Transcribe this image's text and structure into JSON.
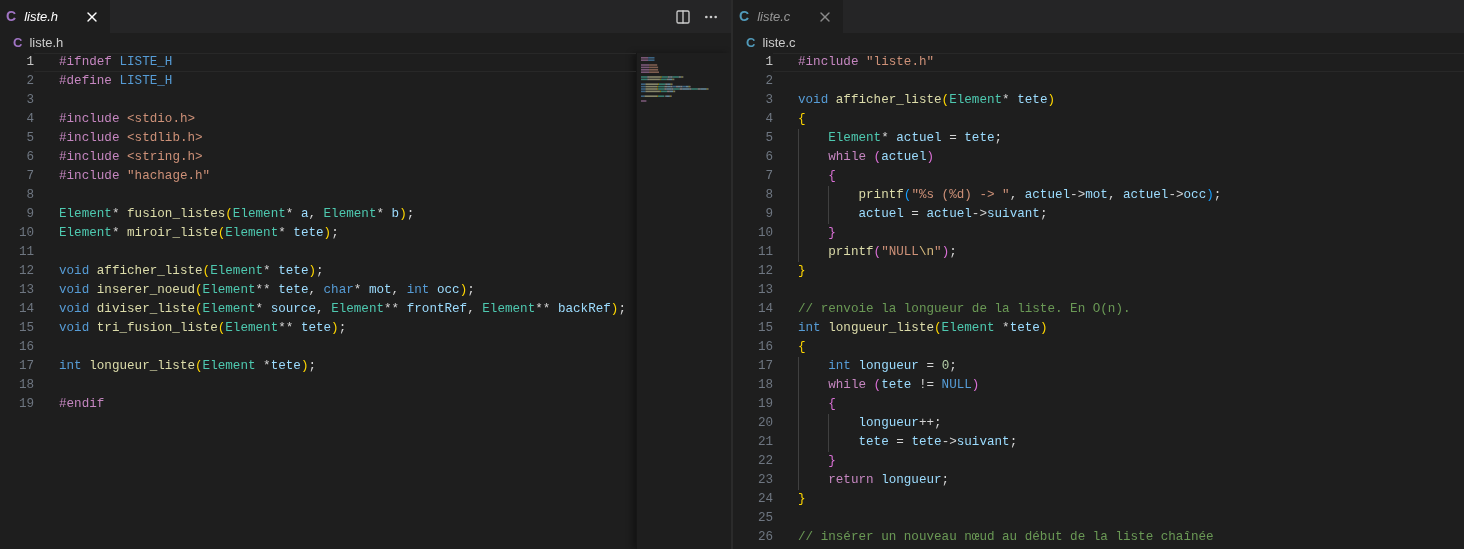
{
  "groups": [
    {
      "focused": true,
      "minimap": true,
      "tabs": [
        {
          "icon": "C",
          "color": "#a074c4",
          "label": "liste.h",
          "selected": true
        }
      ],
      "breadcrumb": {
        "icon": "C",
        "color": "#a074c4",
        "label": "liste.h"
      },
      "lines": [
        {
          "n": "1",
          "current": true,
          "tokens": [
            {
              "kind": "pp",
              "text": "#ifndef "
            },
            {
              "kind": "mac",
              "text": "LISTE_H"
            }
          ]
        },
        {
          "n": "2",
          "current": false,
          "tokens": [
            {
              "kind": "pp",
              "text": "#define "
            },
            {
              "kind": "mac",
              "text": "LISTE_H"
            }
          ]
        },
        {
          "n": "3",
          "current": false
        },
        {
          "n": "4",
          "current": false,
          "tokens": [
            {
              "kind": "pp",
              "text": "#include "
            },
            {
              "kind": "str",
              "text": "<stdio.h>"
            }
          ]
        },
        {
          "n": "5",
          "current": false,
          "tokens": [
            {
              "kind": "pp",
              "text": "#include "
            },
            {
              "kind": "str",
              "text": "<stdlib.h>"
            }
          ]
        },
        {
          "n": "6",
          "current": false,
          "tokens": [
            {
              "kind": "pp",
              "text": "#include "
            },
            {
              "kind": "str",
              "text": "<string.h>"
            }
          ]
        },
        {
          "n": "7",
          "current": false,
          "tokens": [
            {
              "kind": "pp",
              "text": "#include "
            },
            {
              "kind": "str",
              "text": "\"hachage.h\""
            }
          ]
        },
        {
          "n": "8",
          "current": false
        },
        {
          "n": "9",
          "current": false,
          "tokens": [
            {
              "kind": "type",
              "text": "Element"
            },
            {
              "kind": "p",
              "text": "* "
            },
            {
              "kind": "fn",
              "text": "fusion_listes"
            },
            {
              "kind": "b1",
              "text": "("
            },
            {
              "kind": "type",
              "text": "Element"
            },
            {
              "kind": "p",
              "text": "* "
            },
            {
              "kind": "var",
              "text": "a"
            },
            {
              "kind": "p",
              "text": ", "
            },
            {
              "kind": "type",
              "text": "Element"
            },
            {
              "kind": "p",
              "text": "* "
            },
            {
              "kind": "var",
              "text": "b"
            },
            {
              "kind": "b1",
              "text": ")"
            },
            {
              "kind": "p",
              "text": ";"
            }
          ]
        },
        {
          "n": "10",
          "current": false,
          "tokens": [
            {
              "kind": "type",
              "text": "Element"
            },
            {
              "kind": "p",
              "text": "* "
            },
            {
              "kind": "fn",
              "text": "miroir_liste"
            },
            {
              "kind": "b1",
              "text": "("
            },
            {
              "kind": "type",
              "text": "Element"
            },
            {
              "kind": "p",
              "text": "* "
            },
            {
              "kind": "var",
              "text": "tete"
            },
            {
              "kind": "b1",
              "text": ")"
            },
            {
              "kind": "p",
              "text": ";"
            }
          ]
        },
        {
          "n": "11",
          "current": false
        },
        {
          "n": "12",
          "current": false,
          "tokens": [
            {
              "kind": "kw",
              "text": "void "
            },
            {
              "kind": "fn",
              "text": "afficher_liste"
            },
            {
              "kind": "b1",
              "text": "("
            },
            {
              "kind": "type",
              "text": "Element"
            },
            {
              "kind": "p",
              "text": "* "
            },
            {
              "kind": "var",
              "text": "tete"
            },
            {
              "kind": "b1",
              "text": ")"
            },
            {
              "kind": "p",
              "text": ";"
            }
          ]
        },
        {
          "n": "13",
          "current": false,
          "tokens": [
            {
              "kind": "kw",
              "text": "void "
            },
            {
              "kind": "fn",
              "text": "inserer_noeud"
            },
            {
              "kind": "b1",
              "text": "("
            },
            {
              "kind": "type",
              "text": "Element"
            },
            {
              "kind": "p",
              "text": "** "
            },
            {
              "kind": "var",
              "text": "tete"
            },
            {
              "kind": "p",
              "text": ", "
            },
            {
              "kind": "kw",
              "text": "char"
            },
            {
              "kind": "p",
              "text": "* "
            },
            {
              "kind": "var",
              "text": "mot"
            },
            {
              "kind": "p",
              "text": ", "
            },
            {
              "kind": "kw",
              "text": "int "
            },
            {
              "kind": "var",
              "text": "occ"
            },
            {
              "kind": "b1",
              "text": ")"
            },
            {
              "kind": "p",
              "text": ";"
            }
          ]
        },
        {
          "n": "14",
          "current": false,
          "tokens": [
            {
              "kind": "kw",
              "text": "void "
            },
            {
              "kind": "fn",
              "text": "diviser_liste"
            },
            {
              "kind": "b1",
              "text": "("
            },
            {
              "kind": "type",
              "text": "Element"
            },
            {
              "kind": "p",
              "text": "* "
            },
            {
              "kind": "var",
              "text": "source"
            },
            {
              "kind": "p",
              "text": ", "
            },
            {
              "kind": "type",
              "text": "Element"
            },
            {
              "kind": "p",
              "text": "** "
            },
            {
              "kind": "var",
              "text": "frontRef"
            },
            {
              "kind": "p",
              "text": ", "
            },
            {
              "kind": "type",
              "text": "Element"
            },
            {
              "kind": "p",
              "text": "** "
            },
            {
              "kind": "var",
              "text": "backRef"
            },
            {
              "kind": "b1",
              "text": ")"
            },
            {
              "kind": "p",
              "text": ";"
            }
          ]
        },
        {
          "n": "15",
          "current": false,
          "tokens": [
            {
              "kind": "kw",
              "text": "void "
            },
            {
              "kind": "fn",
              "text": "tri_fusion_liste"
            },
            {
              "kind": "b1",
              "text": "("
            },
            {
              "kind": "type",
              "text": "Element"
            },
            {
              "kind": "p",
              "text": "** "
            },
            {
              "kind": "var",
              "text": "tete"
            },
            {
              "kind": "b1",
              "text": ")"
            },
            {
              "kind": "p",
              "text": ";"
            }
          ]
        },
        {
          "n": "16",
          "current": false
        },
        {
          "n": "17",
          "current": false,
          "tokens": [
            {
              "kind": "kw",
              "text": "int "
            },
            {
              "kind": "fn",
              "text": "longueur_liste"
            },
            {
              "kind": "b1",
              "text": "("
            },
            {
              "kind": "type",
              "text": "Element"
            },
            {
              "kind": "p",
              "text": " *"
            },
            {
              "kind": "var",
              "text": "tete"
            },
            {
              "kind": "b1",
              "text": ")"
            },
            {
              "kind": "p",
              "text": ";"
            }
          ]
        },
        {
          "n": "18",
          "current": false
        },
        {
          "n": "19",
          "current": false,
          "tokens": [
            {
              "kind": "pp",
              "text": "#endif"
            }
          ]
        }
      ]
    },
    {
      "focused": false,
      "minimap": false,
      "tabs": [
        {
          "icon": "C",
          "color": "#519aba",
          "label": "liste.c",
          "selected": true
        }
      ],
      "breadcrumb": {
        "icon": "C",
        "color": "#519aba",
        "label": "liste.c"
      },
      "lines": [
        {
          "n": "1",
          "current": true,
          "tokens": [
            {
              "kind": "pp",
              "text": "#include "
            },
            {
              "kind": "str",
              "text": "\"liste.h\""
            }
          ]
        },
        {
          "n": "2",
          "current": false
        },
        {
          "n": "3",
          "current": false,
          "tokens": [
            {
              "kind": "kw",
              "text": "void "
            },
            {
              "kind": "fn",
              "text": "afficher_liste"
            },
            {
              "kind": "b1",
              "text": "("
            },
            {
              "kind": "type",
              "text": "Element"
            },
            {
              "kind": "p",
              "text": "* "
            },
            {
              "kind": "var",
              "text": "tete"
            },
            {
              "kind": "b1",
              "text": ")"
            }
          ]
        },
        {
          "n": "4",
          "current": false,
          "tokens": [
            {
              "kind": "b1",
              "text": "{"
            }
          ]
        },
        {
          "n": "5",
          "current": false,
          "tokens": [
            {
              "kind": "type",
              "text": "    Element"
            },
            {
              "kind": "p",
              "text": "* "
            },
            {
              "kind": "var",
              "text": "actuel"
            },
            {
              "kind": "p",
              "text": " = "
            },
            {
              "kind": "var",
              "text": "tete"
            },
            {
              "kind": "p",
              "text": ";"
            }
          ]
        },
        {
          "n": "6",
          "current": false,
          "tokens": [
            {
              "kind": "ctl",
              "text": "    while "
            },
            {
              "kind": "b2",
              "text": "("
            },
            {
              "kind": "var",
              "text": "actuel"
            },
            {
              "kind": "b2",
              "text": ")"
            }
          ]
        },
        {
          "n": "7",
          "current": false,
          "tokens": [
            {
              "kind": "b2",
              "text": "    {"
            }
          ]
        },
        {
          "n": "8",
          "current": false,
          "tokens": [
            {
              "kind": "fn",
              "text": "        printf"
            },
            {
              "kind": "b3",
              "text": "("
            },
            {
              "kind": "str",
              "text": "\"%s (%d) -> \""
            },
            {
              "kind": "p",
              "text": ", "
            },
            {
              "kind": "var",
              "text": "actuel"
            },
            {
              "kind": "p",
              "text": "->"
            },
            {
              "kind": "var",
              "text": "mot"
            },
            {
              "kind": "p",
              "text": ", "
            },
            {
              "kind": "var",
              "text": "actuel"
            },
            {
              "kind": "p",
              "text": "->"
            },
            {
              "kind": "var",
              "text": "occ"
            },
            {
              "kind": "b3",
              "text": ")"
            },
            {
              "kind": "p",
              "text": ";"
            }
          ]
        },
        {
          "n": "9",
          "current": false,
          "tokens": [
            {
              "kind": "var",
              "text": "        actuel"
            },
            {
              "kind": "p",
              "text": " = "
            },
            {
              "kind": "var",
              "text": "actuel"
            },
            {
              "kind": "p",
              "text": "->"
            },
            {
              "kind": "var",
              "text": "suivant"
            },
            {
              "kind": "p",
              "text": ";"
            }
          ]
        },
        {
          "n": "10",
          "current": false,
          "tokens": [
            {
              "kind": "b2",
              "text": "    }"
            }
          ]
        },
        {
          "n": "11",
          "current": false,
          "tokens": [
            {
              "kind": "fn",
              "text": "    printf"
            },
            {
              "kind": "b2",
              "text": "("
            },
            {
              "kind": "str",
              "text": "\"NULL"
            },
            {
              "kind": "esc",
              "text": "\\n"
            },
            {
              "kind": "str",
              "text": "\""
            },
            {
              "kind": "b2",
              "text": ")"
            },
            {
              "kind": "p",
              "text": ";"
            }
          ]
        },
        {
          "n": "12",
          "current": false,
          "tokens": [
            {
              "kind": "b1",
              "text": "}"
            }
          ]
        },
        {
          "n": "13",
          "current": false
        },
        {
          "n": "14",
          "current": false,
          "tokens": [
            {
              "kind": "cm",
              "text": "// renvoie la longueur de la liste. En O(n)."
            }
          ]
        },
        {
          "n": "15",
          "current": false,
          "tokens": [
            {
              "kind": "kw",
              "text": "int "
            },
            {
              "kind": "fn",
              "text": "longueur_liste"
            },
            {
              "kind": "b1",
              "text": "("
            },
            {
              "kind": "type",
              "text": "Element"
            },
            {
              "kind": "p",
              "text": " *"
            },
            {
              "kind": "var",
              "text": "tete"
            },
            {
              "kind": "b1",
              "text": ")"
            }
          ]
        },
        {
          "n": "16",
          "current": false,
          "tokens": [
            {
              "kind": "b1",
              "text": "{"
            }
          ]
        },
        {
          "n": "17",
          "current": false,
          "tokens": [
            {
              "kind": "kw",
              "text": "    int "
            },
            {
              "kind": "var",
              "text": "longueur"
            },
            {
              "kind": "p",
              "text": " = "
            },
            {
              "kind": "num",
              "text": "0"
            },
            {
              "kind": "p",
              "text": ";"
            }
          ]
        },
        {
          "n": "18",
          "current": false,
          "tokens": [
            {
              "kind": "ctl",
              "text": "    while "
            },
            {
              "kind": "b2",
              "text": "("
            },
            {
              "kind": "var",
              "text": "tete"
            },
            {
              "kind": "p",
              "text": " != "
            },
            {
              "kind": "mac",
              "text": "NULL"
            },
            {
              "kind": "b2",
              "text": ")"
            }
          ]
        },
        {
          "n": "19",
          "current": false,
          "tokens": [
            {
              "kind": "b2",
              "text": "    {"
            }
          ]
        },
        {
          "n": "20",
          "current": false,
          "tokens": [
            {
              "kind": "var",
              "text": "        longueur"
            },
            {
              "kind": "p",
              "text": "++;"
            }
          ]
        },
        {
          "n": "21",
          "current": false,
          "tokens": [
            {
              "kind": "var",
              "text": "        tete"
            },
            {
              "kind": "p",
              "text": " = "
            },
            {
              "kind": "var",
              "text": "tete"
            },
            {
              "kind": "p",
              "text": "->"
            },
            {
              "kind": "var",
              "text": "suivant"
            },
            {
              "kind": "p",
              "text": ";"
            }
          ]
        },
        {
          "n": "22",
          "current": false,
          "tokens": [
            {
              "kind": "b2",
              "text": "    }"
            }
          ]
        },
        {
          "n": "23",
          "current": false,
          "tokens": [
            {
              "kind": "ctl",
              "text": "    return "
            },
            {
              "kind": "var",
              "text": "longueur"
            },
            {
              "kind": "p",
              "text": ";"
            }
          ]
        },
        {
          "n": "24",
          "current": false,
          "tokens": [
            {
              "kind": "b1",
              "text": "}"
            }
          ]
        },
        {
          "n": "25",
          "current": false
        },
        {
          "n": "26",
          "current": false,
          "tokens": [
            {
              "kind": "cm",
              "text": "// insérer un nouveau nœud au début de la liste chaînée"
            }
          ]
        }
      ]
    }
  ]
}
